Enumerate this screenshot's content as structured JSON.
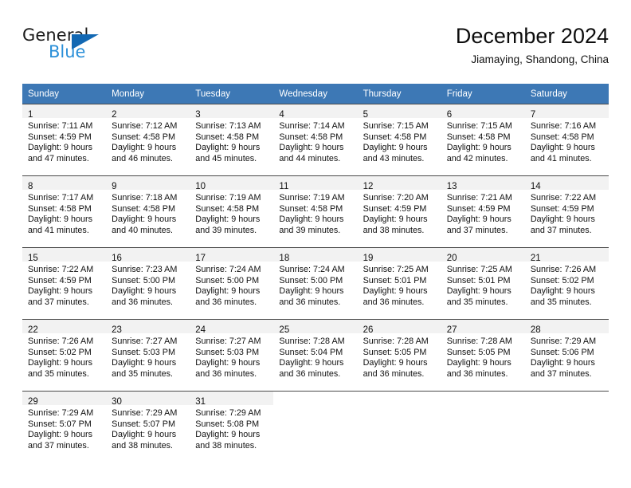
{
  "brand": {
    "name_top": "General",
    "name_bottom": "Blue",
    "triangle_color": "#1268b3",
    "blue_text_color": "#2a8fd8"
  },
  "header": {
    "title": "December 2024",
    "subtitle": "Jiamaying, Shandong, China"
  },
  "theme": {
    "header_row_bg": "#3d78b5",
    "header_row_text": "#ffffff",
    "daynum_band_bg": "#f2f2f2",
    "row_divider": "#4a4a4a"
  },
  "weekday_headers": [
    "Sunday",
    "Monday",
    "Tuesday",
    "Wednesday",
    "Thursday",
    "Friday",
    "Saturday"
  ],
  "weeks": [
    [
      {
        "day": "1",
        "sunrise": "Sunrise: 7:11 AM",
        "sunset": "Sunset: 4:59 PM",
        "daylight1": "Daylight: 9 hours",
        "daylight2": "and 47 minutes."
      },
      {
        "day": "2",
        "sunrise": "Sunrise: 7:12 AM",
        "sunset": "Sunset: 4:58 PM",
        "daylight1": "Daylight: 9 hours",
        "daylight2": "and 46 minutes."
      },
      {
        "day": "3",
        "sunrise": "Sunrise: 7:13 AM",
        "sunset": "Sunset: 4:58 PM",
        "daylight1": "Daylight: 9 hours",
        "daylight2": "and 45 minutes."
      },
      {
        "day": "4",
        "sunrise": "Sunrise: 7:14 AM",
        "sunset": "Sunset: 4:58 PM",
        "daylight1": "Daylight: 9 hours",
        "daylight2": "and 44 minutes."
      },
      {
        "day": "5",
        "sunrise": "Sunrise: 7:15 AM",
        "sunset": "Sunset: 4:58 PM",
        "daylight1": "Daylight: 9 hours",
        "daylight2": "and 43 minutes."
      },
      {
        "day": "6",
        "sunrise": "Sunrise: 7:15 AM",
        "sunset": "Sunset: 4:58 PM",
        "daylight1": "Daylight: 9 hours",
        "daylight2": "and 42 minutes."
      },
      {
        "day": "7",
        "sunrise": "Sunrise: 7:16 AM",
        "sunset": "Sunset: 4:58 PM",
        "daylight1": "Daylight: 9 hours",
        "daylight2": "and 41 minutes."
      }
    ],
    [
      {
        "day": "8",
        "sunrise": "Sunrise: 7:17 AM",
        "sunset": "Sunset: 4:58 PM",
        "daylight1": "Daylight: 9 hours",
        "daylight2": "and 41 minutes."
      },
      {
        "day": "9",
        "sunrise": "Sunrise: 7:18 AM",
        "sunset": "Sunset: 4:58 PM",
        "daylight1": "Daylight: 9 hours",
        "daylight2": "and 40 minutes."
      },
      {
        "day": "10",
        "sunrise": "Sunrise: 7:19 AM",
        "sunset": "Sunset: 4:58 PM",
        "daylight1": "Daylight: 9 hours",
        "daylight2": "and 39 minutes."
      },
      {
        "day": "11",
        "sunrise": "Sunrise: 7:19 AM",
        "sunset": "Sunset: 4:58 PM",
        "daylight1": "Daylight: 9 hours",
        "daylight2": "and 39 minutes."
      },
      {
        "day": "12",
        "sunrise": "Sunrise: 7:20 AM",
        "sunset": "Sunset: 4:59 PM",
        "daylight1": "Daylight: 9 hours",
        "daylight2": "and 38 minutes."
      },
      {
        "day": "13",
        "sunrise": "Sunrise: 7:21 AM",
        "sunset": "Sunset: 4:59 PM",
        "daylight1": "Daylight: 9 hours",
        "daylight2": "and 37 minutes."
      },
      {
        "day": "14",
        "sunrise": "Sunrise: 7:22 AM",
        "sunset": "Sunset: 4:59 PM",
        "daylight1": "Daylight: 9 hours",
        "daylight2": "and 37 minutes."
      }
    ],
    [
      {
        "day": "15",
        "sunrise": "Sunrise: 7:22 AM",
        "sunset": "Sunset: 4:59 PM",
        "daylight1": "Daylight: 9 hours",
        "daylight2": "and 37 minutes."
      },
      {
        "day": "16",
        "sunrise": "Sunrise: 7:23 AM",
        "sunset": "Sunset: 5:00 PM",
        "daylight1": "Daylight: 9 hours",
        "daylight2": "and 36 minutes."
      },
      {
        "day": "17",
        "sunrise": "Sunrise: 7:24 AM",
        "sunset": "Sunset: 5:00 PM",
        "daylight1": "Daylight: 9 hours",
        "daylight2": "and 36 minutes."
      },
      {
        "day": "18",
        "sunrise": "Sunrise: 7:24 AM",
        "sunset": "Sunset: 5:00 PM",
        "daylight1": "Daylight: 9 hours",
        "daylight2": "and 36 minutes."
      },
      {
        "day": "19",
        "sunrise": "Sunrise: 7:25 AM",
        "sunset": "Sunset: 5:01 PM",
        "daylight1": "Daylight: 9 hours",
        "daylight2": "and 36 minutes."
      },
      {
        "day": "20",
        "sunrise": "Sunrise: 7:25 AM",
        "sunset": "Sunset: 5:01 PM",
        "daylight1": "Daylight: 9 hours",
        "daylight2": "and 35 minutes."
      },
      {
        "day": "21",
        "sunrise": "Sunrise: 7:26 AM",
        "sunset": "Sunset: 5:02 PM",
        "daylight1": "Daylight: 9 hours",
        "daylight2": "and 35 minutes."
      }
    ],
    [
      {
        "day": "22",
        "sunrise": "Sunrise: 7:26 AM",
        "sunset": "Sunset: 5:02 PM",
        "daylight1": "Daylight: 9 hours",
        "daylight2": "and 35 minutes."
      },
      {
        "day": "23",
        "sunrise": "Sunrise: 7:27 AM",
        "sunset": "Sunset: 5:03 PM",
        "daylight1": "Daylight: 9 hours",
        "daylight2": "and 35 minutes."
      },
      {
        "day": "24",
        "sunrise": "Sunrise: 7:27 AM",
        "sunset": "Sunset: 5:03 PM",
        "daylight1": "Daylight: 9 hours",
        "daylight2": "and 36 minutes."
      },
      {
        "day": "25",
        "sunrise": "Sunrise: 7:28 AM",
        "sunset": "Sunset: 5:04 PM",
        "daylight1": "Daylight: 9 hours",
        "daylight2": "and 36 minutes."
      },
      {
        "day": "26",
        "sunrise": "Sunrise: 7:28 AM",
        "sunset": "Sunset: 5:05 PM",
        "daylight1": "Daylight: 9 hours",
        "daylight2": "and 36 minutes."
      },
      {
        "day": "27",
        "sunrise": "Sunrise: 7:28 AM",
        "sunset": "Sunset: 5:05 PM",
        "daylight1": "Daylight: 9 hours",
        "daylight2": "and 36 minutes."
      },
      {
        "day": "28",
        "sunrise": "Sunrise: 7:29 AM",
        "sunset": "Sunset: 5:06 PM",
        "daylight1": "Daylight: 9 hours",
        "daylight2": "and 37 minutes."
      }
    ],
    [
      {
        "day": "29",
        "sunrise": "Sunrise: 7:29 AM",
        "sunset": "Sunset: 5:07 PM",
        "daylight1": "Daylight: 9 hours",
        "daylight2": "and 37 minutes."
      },
      {
        "day": "30",
        "sunrise": "Sunrise: 7:29 AM",
        "sunset": "Sunset: 5:07 PM",
        "daylight1": "Daylight: 9 hours",
        "daylight2": "and 38 minutes."
      },
      {
        "day": "31",
        "sunrise": "Sunrise: 7:29 AM",
        "sunset": "Sunset: 5:08 PM",
        "daylight1": "Daylight: 9 hours",
        "daylight2": "and 38 minutes."
      },
      {
        "day": "",
        "sunrise": "",
        "sunset": "",
        "daylight1": "",
        "daylight2": ""
      },
      {
        "day": "",
        "sunrise": "",
        "sunset": "",
        "daylight1": "",
        "daylight2": ""
      },
      {
        "day": "",
        "sunrise": "",
        "sunset": "",
        "daylight1": "",
        "daylight2": ""
      },
      {
        "day": "",
        "sunrise": "",
        "sunset": "",
        "daylight1": "",
        "daylight2": ""
      }
    ]
  ]
}
